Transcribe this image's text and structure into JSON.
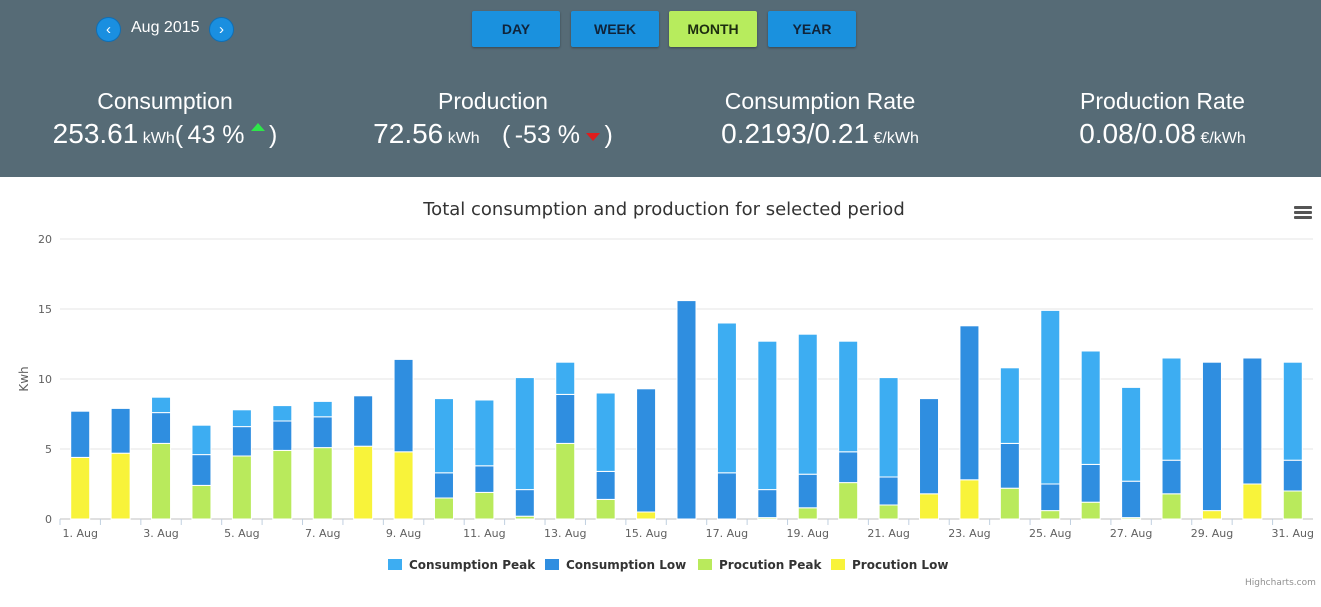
{
  "header": {
    "period": "Aug 2015",
    "prev_icon": "chevron-left-icon",
    "next_icon": "chevron-right-icon",
    "prev_glyph": "‹",
    "next_glyph": "›",
    "ranges": [
      {
        "label": "DAY",
        "active": false
      },
      {
        "label": "WEEK",
        "active": false
      },
      {
        "label": "MONTH",
        "active": true
      },
      {
        "label": "YEAR",
        "active": false
      }
    ]
  },
  "stats": {
    "consumption": {
      "title": "Consumption",
      "value": "253.61",
      "unit": "kWh",
      "open": "(",
      "change": "43 %",
      "close": ")",
      "trend": "up",
      "trend_color": "#2ee64a"
    },
    "production": {
      "title": "Production",
      "value": "72.56",
      "unit": "kWh",
      "open": "(",
      "change": "-53 %",
      "close": ")",
      "trend": "down",
      "trend_color": "#e01c1c"
    },
    "consumption_rate": {
      "title": "Consumption Rate",
      "value": "0.2193/0.21",
      "unit": "€/kWh"
    },
    "production_rate": {
      "title": "Production Rate",
      "value": "0.08/0.08",
      "unit": "€/kWh"
    }
  },
  "colors": {
    "header_bg": "#566b76",
    "button_blue": "#1a91de",
    "button_active": "#b7ec5d",
    "consumption_peak": "#3dadf2",
    "consumption_low": "#2f8ee0",
    "production_peak": "#b9ea5c",
    "production_low": "#f8f33a"
  },
  "menu_icon": "hamburger-menu-icon",
  "credits": "Highcharts.com",
  "chart_data": {
    "type": "bar",
    "stacked": true,
    "title": "Total consumption and production for selected period",
    "ylabel": "Kwh",
    "xlabel": "",
    "ylim": [
      0,
      20
    ],
    "yticks": [
      0,
      5,
      10,
      15,
      20
    ],
    "grid": true,
    "legend_position": "bottom",
    "categories": [
      "1. Aug",
      "2. Aug",
      "3. Aug",
      "4. Aug",
      "5. Aug",
      "6. Aug",
      "7. Aug",
      "8. Aug",
      "9. Aug",
      "10. Aug",
      "11. Aug",
      "12. Aug",
      "13. Aug",
      "14. Aug",
      "15. Aug",
      "16. Aug",
      "17. Aug",
      "18. Aug",
      "19. Aug",
      "20. Aug",
      "21. Aug",
      "22. Aug",
      "23. Aug",
      "24. Aug",
      "25. Aug",
      "26. Aug",
      "27. Aug",
      "28. Aug",
      "29. Aug",
      "30. Aug",
      "31. Aug"
    ],
    "xtick_labels": [
      "1. Aug",
      "",
      "3. Aug",
      "",
      "5. Aug",
      "",
      "7. Aug",
      "",
      "9. Aug",
      "",
      "11. Aug",
      "",
      "13. Aug",
      "",
      "15. Aug",
      "",
      "17. Aug",
      "",
      "19. Aug",
      "",
      "21. Aug",
      "",
      "23. Aug",
      "",
      "25. Aug",
      "",
      "27. Aug",
      "",
      "29. Aug",
      "",
      "31. Aug"
    ],
    "series": [
      {
        "name": "Consumption Peak",
        "color": "#3dadf2",
        "values": [
          0,
          0,
          1.1,
          2.1,
          1.2,
          1.1,
          1.1,
          0,
          0,
          5.3,
          4.7,
          8.0,
          2.3,
          5.6,
          0,
          0,
          10.7,
          10.6,
          10.0,
          7.9,
          7.1,
          0,
          0,
          5.4,
          12.4,
          8.1,
          6.7,
          7.3,
          0,
          0,
          7.0
        ]
      },
      {
        "name": "Consumption Low",
        "color": "#2f8ee0",
        "values": [
          3.3,
          3.2,
          2.2,
          2.2,
          2.1,
          2.1,
          2.2,
          3.6,
          6.6,
          1.8,
          1.9,
          1.9,
          3.5,
          2.0,
          8.8,
          15.6,
          3.3,
          2.0,
          2.4,
          2.2,
          2.0,
          6.8,
          11.0,
          3.2,
          1.9,
          2.7,
          2.6,
          2.4,
          10.6,
          9.0,
          2.2
        ]
      },
      {
        "name": "Procution Peak",
        "color": "#b9ea5c",
        "values": [
          0,
          0,
          5.4,
          2.4,
          4.5,
          4.9,
          5.1,
          0,
          0,
          1.5,
          1.9,
          0.2,
          5.4,
          1.4,
          0,
          0,
          0,
          0.1,
          0.8,
          2.6,
          1.0,
          0,
          0,
          2.2,
          0.6,
          1.2,
          0.1,
          1.8,
          0,
          0,
          2.0
        ]
      },
      {
        "name": "Procution Low",
        "color": "#f8f33a",
        "values": [
          4.4,
          4.7,
          0,
          0,
          0,
          0,
          0,
          5.2,
          4.8,
          0,
          0,
          0,
          0,
          0,
          0.5,
          0,
          0,
          0,
          0,
          0,
          0,
          1.8,
          2.8,
          0,
          0,
          0,
          0,
          0,
          0.6,
          2.5,
          0
        ]
      }
    ]
  }
}
